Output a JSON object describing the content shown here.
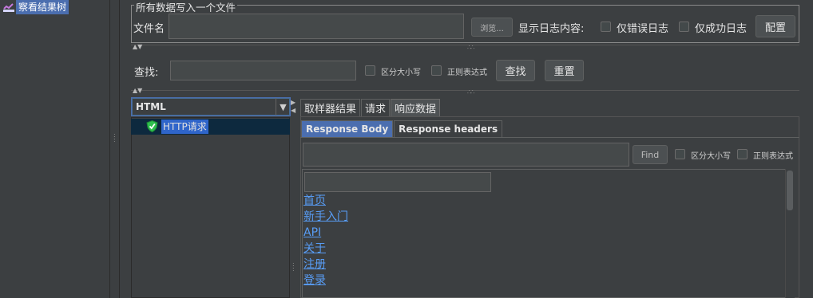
{
  "tree": {
    "label": "察看结果树"
  },
  "file_group": {
    "legend": "所有数据写入一个文件",
    "filename_label": "文件名",
    "filename_value": "",
    "browse_label": "浏览...",
    "log_label": "显示日志内容:",
    "errors_only_label": "仅错误日志",
    "success_only_label": "仅成功日志",
    "configure_label": "配置"
  },
  "search": {
    "label": "查找:",
    "value": "",
    "case_label": "区分大小写",
    "regex_label": "正则表达式",
    "find_label": "查找",
    "reset_label": "重置"
  },
  "renderer": {
    "selected": "HTML"
  },
  "samples": [
    {
      "label": "HTTP请求",
      "status": "success"
    }
  ],
  "tabs": [
    {
      "label": "取样器结果",
      "active": false
    },
    {
      "label": "请求",
      "active": false
    },
    {
      "label": "响应数据",
      "active": true
    }
  ],
  "subtabs": [
    {
      "label": "Response Body",
      "active": true
    },
    {
      "label": "Response headers",
      "active": false
    }
  ],
  "response_search": {
    "value": "",
    "find_label": "Find",
    "case_label": "区分大小写",
    "regex_label": "正则表达式"
  },
  "html_links": [
    "首页",
    "新手入门",
    "API",
    "关于",
    "注册",
    "登录"
  ],
  "colors": {
    "background": "#3c3f41",
    "selection": "#4b6eaf",
    "link": "#589df6",
    "success": "#2fbf4e"
  }
}
